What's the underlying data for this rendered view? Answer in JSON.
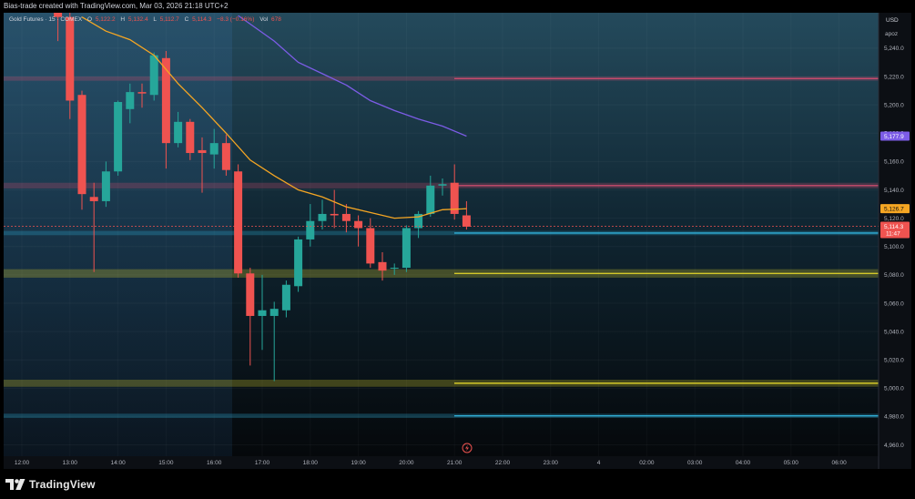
{
  "header": {
    "attribution": "Bias-trade created with TradingView.com, Mar 03, 2026 21:18 UTC+2"
  },
  "legend": {
    "symbol": "Gold Futures · 15 · COMEX",
    "o_label": "O",
    "o_value": "5,122.2",
    "h_label": "H",
    "h_value": "5,132.4",
    "l_label": "L",
    "l_value": "5,112.7",
    "c_label": "C",
    "c_value": "5,114.3",
    "change": "−8.3 (−0.16%)",
    "vol_label": "Vol",
    "vol_value": "678"
  },
  "price_scale": {
    "currency": "USD",
    "mode": "apoz",
    "tag_purple": "5,177.9",
    "tag_orange": "5,126.7",
    "tag_last": "5,114.3",
    "tag_countdown": "11:47"
  },
  "colors": {
    "up": "#26a69a",
    "down": "#ef5350",
    "ema_fast": "#f5a623",
    "ema_slow": "#7c5ce6",
    "zone_yellow": "#d4c82a",
    "zone_cyan": "#30b0d8",
    "zone_red": "#c94b6d"
  },
  "chart_data": {
    "type": "candlestick",
    "x_ticks": [
      "12:00",
      "13:00",
      "14:00",
      "15:00",
      "16:00",
      "17:00",
      "18:00",
      "19:00",
      "20:00",
      "21:00",
      "22:00",
      "23:00",
      "4",
      "02:00",
      "03:00",
      "04:00",
      "05:00",
      "06:00"
    ],
    "y_ticks": [
      4960,
      4980,
      5000,
      5020,
      5040,
      5060,
      5080,
      5100,
      5120,
      5140,
      5160,
      5180,
      5200,
      5220,
      5240
    ],
    "y_tick_labels": [
      "4,960.0",
      "4,980.0",
      "5,000.0",
      "5,020.0",
      "5,040.0",
      "5,060.0",
      "5,080.0",
      "5,100.0",
      "5,120.0",
      "5,140.0",
      "5,160.0",
      "5,180.0",
      "5,200.0",
      "5,220.0",
      "5,240.0"
    ],
    "ylim": [
      4952,
      5265
    ],
    "interval_minutes": 15,
    "candles": [
      {
        "t": "12:45",
        "o": 5271,
        "h": 5275,
        "l": 5245,
        "c": 5262
      },
      {
        "t": "13:00",
        "o": 5262,
        "h": 5265,
        "l": 5190,
        "c": 5203
      },
      {
        "t": "13:15",
        "o": 5207,
        "h": 5210,
        "l": 5126,
        "c": 5137
      },
      {
        "t": "13:30",
        "o": 5135,
        "h": 5145,
        "l": 5082,
        "c": 5132
      },
      {
        "t": "13:45",
        "o": 5132,
        "h": 5160,
        "l": 5128,
        "c": 5153
      },
      {
        "t": "14:00",
        "o": 5153,
        "h": 5203,
        "l": 5150,
        "c": 5202
      },
      {
        "t": "14:15",
        "o": 5197,
        "h": 5215,
        "l": 5187,
        "c": 5209
      },
      {
        "t": "14:30",
        "o": 5209,
        "h": 5215,
        "l": 5198,
        "c": 5208
      },
      {
        "t": "14:45",
        "o": 5207,
        "h": 5237,
        "l": 5203,
        "c": 5235
      },
      {
        "t": "15:00",
        "o": 5233,
        "h": 5238,
        "l": 5155,
        "c": 5173
      },
      {
        "t": "15:15",
        "o": 5173,
        "h": 5195,
        "l": 5170,
        "c": 5188
      },
      {
        "t": "15:30",
        "o": 5188,
        "h": 5190,
        "l": 5161,
        "c": 5166
      },
      {
        "t": "15:45",
        "o": 5168,
        "h": 5177,
        "l": 5138,
        "c": 5166
      },
      {
        "t": "16:00",
        "o": 5165,
        "h": 5183,
        "l": 5155,
        "c": 5173
      },
      {
        "t": "16:15",
        "o": 5173,
        "h": 5179,
        "l": 5150,
        "c": 5154
      },
      {
        "t": "16:30",
        "o": 5153,
        "h": 5158,
        "l": 5078,
        "c": 5081
      },
      {
        "t": "16:45",
        "o": 5081,
        "h": 5085,
        "l": 5016,
        "c": 5051
      },
      {
        "t": "17:00",
        "o": 5051,
        "h": 5080,
        "l": 5027,
        "c": 5055
      },
      {
        "t": "17:15",
        "o": 5051,
        "h": 5061,
        "l": 5005,
        "c": 5056
      },
      {
        "t": "17:30",
        "o": 5055,
        "h": 5076,
        "l": 5050,
        "c": 5073
      },
      {
        "t": "17:45",
        "o": 5072,
        "h": 5107,
        "l": 5068,
        "c": 5105
      },
      {
        "t": "18:00",
        "o": 5105,
        "h": 5130,
        "l": 5100,
        "c": 5118
      },
      {
        "t": "18:15",
        "o": 5118,
        "h": 5133,
        "l": 5112,
        "c": 5123
      },
      {
        "t": "18:30",
        "o": 5123,
        "h": 5140,
        "l": 5113,
        "c": 5122
      },
      {
        "t": "18:45",
        "o": 5123,
        "h": 5130,
        "l": 5110,
        "c": 5118
      },
      {
        "t": "19:00",
        "o": 5118,
        "h": 5122,
        "l": 5100,
        "c": 5113
      },
      {
        "t": "19:15",
        "o": 5113,
        "h": 5120,
        "l": 5085,
        "c": 5088
      },
      {
        "t": "19:30",
        "o": 5089,
        "h": 5096,
        "l": 5076,
        "c": 5083
      },
      {
        "t": "19:45",
        "o": 5085,
        "h": 5088,
        "l": 5080,
        "c": 5085
      },
      {
        "t": "20:00",
        "o": 5085,
        "h": 5115,
        "l": 5082,
        "c": 5113
      },
      {
        "t": "20:15",
        "o": 5113,
        "h": 5125,
        "l": 5106,
        "c": 5123
      },
      {
        "t": "20:30",
        "o": 5123,
        "h": 5150,
        "l": 5121,
        "c": 5143
      },
      {
        "t": "20:45",
        "o": 5143,
        "h": 5148,
        "l": 5136,
        "c": 5144
      },
      {
        "t": "21:00",
        "o": 5145,
        "h": 5158,
        "l": 5119,
        "c": 5123
      },
      {
        "t": "21:15",
        "o": 5122,
        "h": 5132,
        "l": 5112,
        "c": 5114
      }
    ],
    "ema_fast": [
      {
        "t": "13:15",
        "v": 5262
      },
      {
        "t": "13:45",
        "v": 5252
      },
      {
        "t": "14:15",
        "v": 5246
      },
      {
        "t": "14:45",
        "v": 5235
      },
      {
        "t": "15:15",
        "v": 5215
      },
      {
        "t": "15:45",
        "v": 5198
      },
      {
        "t": "16:15",
        "v": 5180
      },
      {
        "t": "16:45",
        "v": 5161
      },
      {
        "t": "17:15",
        "v": 5150
      },
      {
        "t": "17:45",
        "v": 5140
      },
      {
        "t": "18:15",
        "v": 5135
      },
      {
        "t": "18:45",
        "v": 5128
      },
      {
        "t": "19:15",
        "v": 5124
      },
      {
        "t": "19:45",
        "v": 5120
      },
      {
        "t": "20:15",
        "v": 5121
      },
      {
        "t": "20:45",
        "v": 5126
      },
      {
        "t": "21:15",
        "v": 5126.7
      }
    ],
    "ema_slow": [
      {
        "t": "16:30",
        "v": 5263
      },
      {
        "t": "16:45",
        "v": 5257
      },
      {
        "t": "17:15",
        "v": 5245
      },
      {
        "t": "17:45",
        "v": 5230
      },
      {
        "t": "18:15",
        "v": 5222
      },
      {
        "t": "18:45",
        "v": 5214
      },
      {
        "t": "19:15",
        "v": 5203
      },
      {
        "t": "19:45",
        "v": 5196
      },
      {
        "t": "20:15",
        "v": 5190
      },
      {
        "t": "20:45",
        "v": 5185
      },
      {
        "t": "21:15",
        "v": 5177.9
      }
    ],
    "zones": [
      {
        "color": "red",
        "low": 5217,
        "high": 5220
      },
      {
        "color": "red",
        "low": 5141,
        "high": 5145
      },
      {
        "color": "cyan",
        "low": 5108,
        "high": 5111
      },
      {
        "color": "yellow",
        "low": 5078,
        "high": 5084
      },
      {
        "color": "yellow",
        "low": 5001,
        "high": 5006
      },
      {
        "color": "cyan",
        "low": 4979,
        "high": 4982
      }
    ],
    "last_price": 5114.3
  }
}
